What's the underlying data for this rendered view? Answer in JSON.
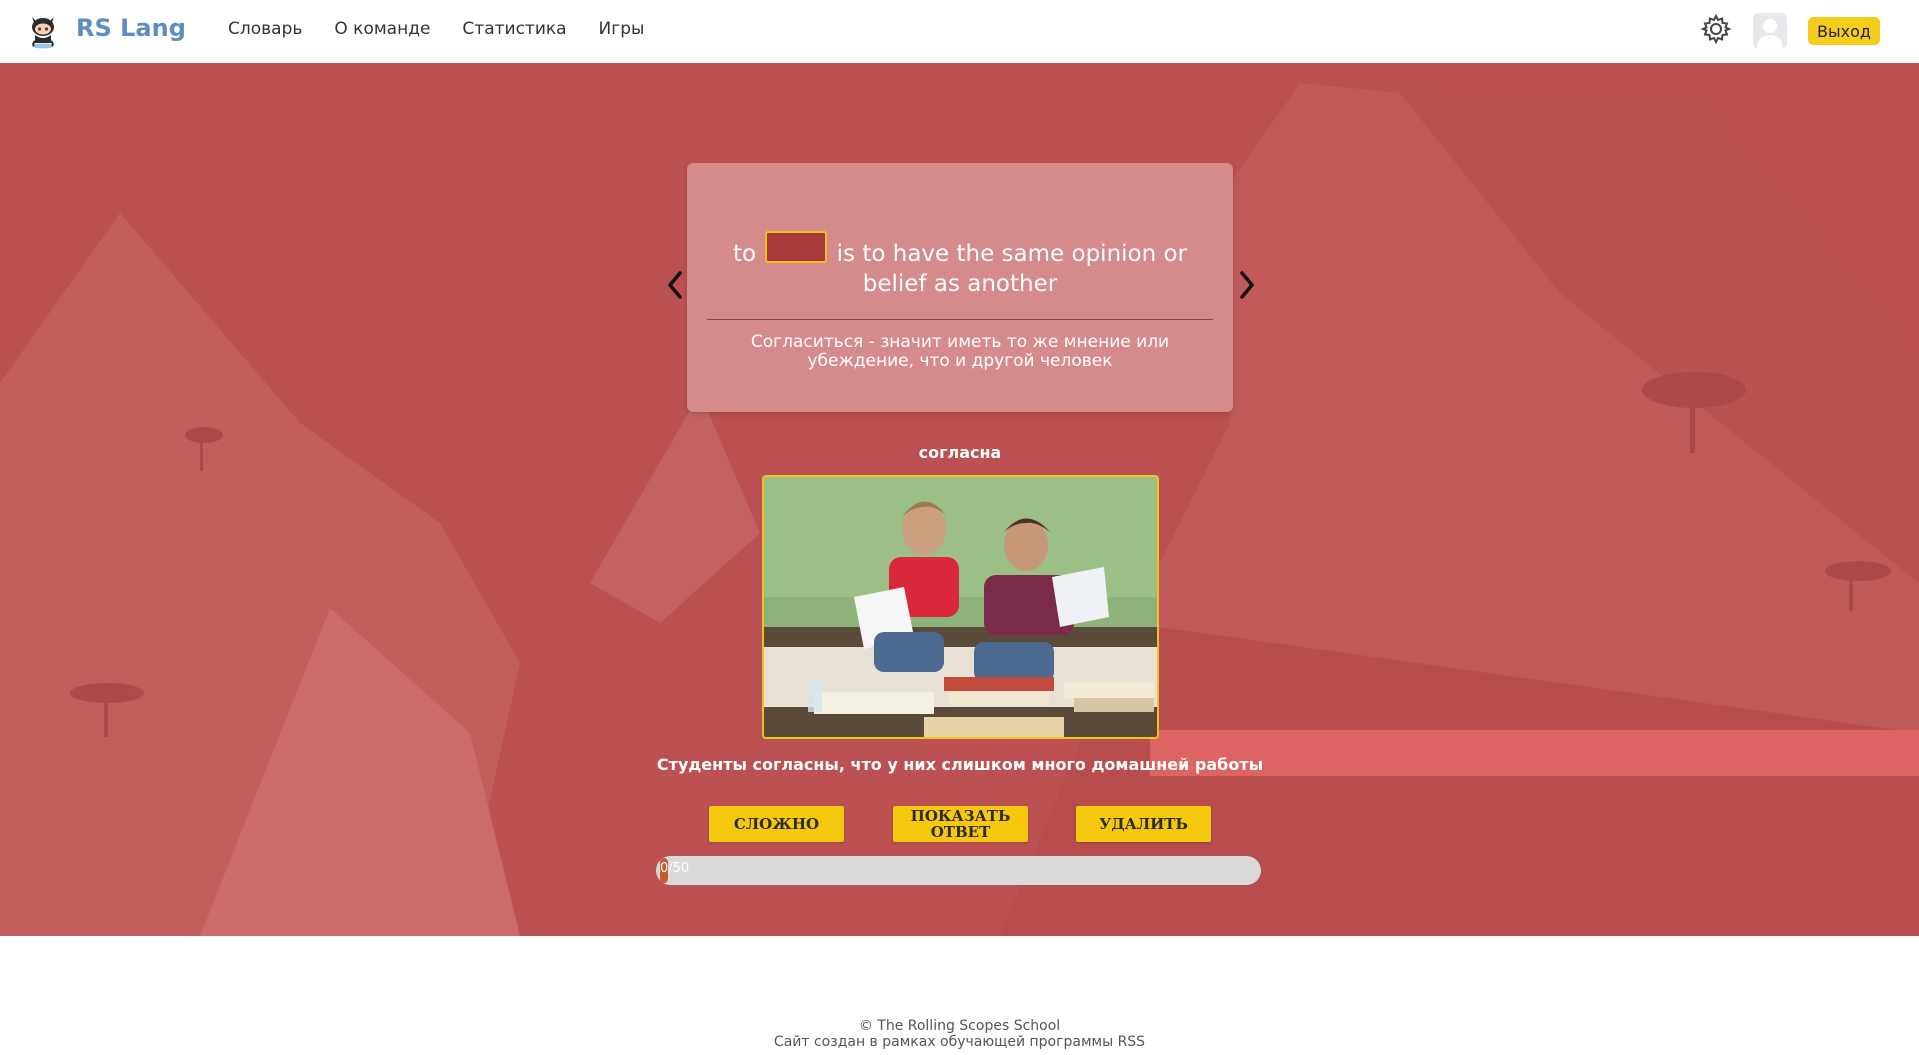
{
  "header": {
    "brand": "RS Lang",
    "nav": [
      "Словарь",
      "О команде",
      "Статистика",
      "Игры"
    ],
    "logout_label": "Выход"
  },
  "card": {
    "sentence_before": "to",
    "sentence_after": "is to have the same opinion or belief as another",
    "translation": "Согласиться - значит иметь то же мнение или убеждение, что и другой человек"
  },
  "word": "согласна",
  "example": "Студенты согласны, что у них слишком много домашней работы",
  "buttons": {
    "hard": "СЛОЖНО",
    "show_answer": "ПОКАЗАТЬ ОТВЕТ",
    "delete": "УДАЛИТЬ"
  },
  "progress": {
    "label": "0/50",
    "value": 0,
    "max": 50
  },
  "footer": {
    "line1": "© The Rolling Scopes School",
    "line2": "Сайт создан в рамках обучающей программы RSS"
  },
  "colors": {
    "background": "#bb5152",
    "card": "#d58a8c",
    "accent": "#f5c80f",
    "brand": "#5b8fc2"
  },
  "icons": {
    "logo": "octocat-icon",
    "settings": "gear-icon",
    "prev": "chevron-left-icon",
    "next": "chevron-right-icon"
  }
}
